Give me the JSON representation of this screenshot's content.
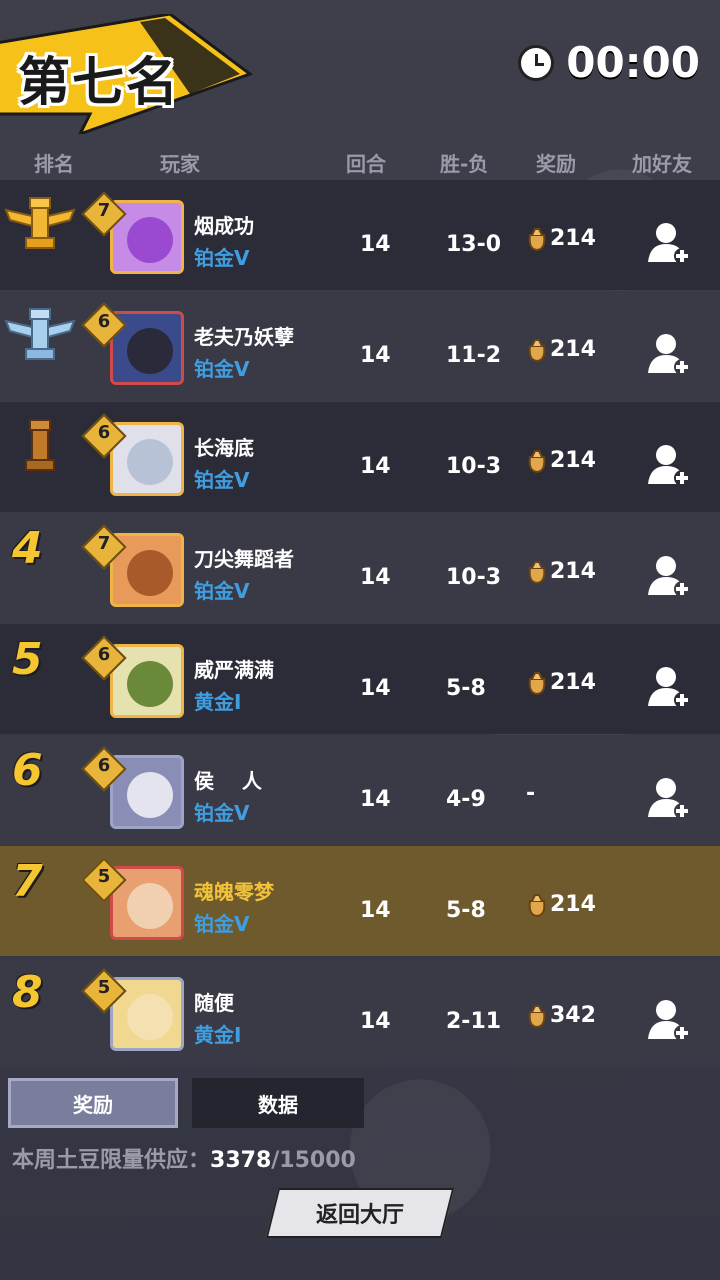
{
  "header": {
    "placement": "第七名",
    "timer": "00:00"
  },
  "columns": {
    "rank": "排名",
    "player": "玩家",
    "rounds": "回合",
    "wl": "胜-负",
    "reward": "奖励",
    "add": "加好友"
  },
  "rows": [
    {
      "rank": "",
      "name": "烟成功",
      "tier": "铂金V",
      "level": "7",
      "rounds": "14",
      "wl": "13-0",
      "reward": "214"
    },
    {
      "rank": "",
      "name": "老夫乃妖孽",
      "tier": "铂金V",
      "level": "6",
      "rounds": "14",
      "wl": "11-2",
      "reward": "214"
    },
    {
      "rank": "",
      "name": "长海底",
      "tier": "铂金V",
      "level": "6",
      "rounds": "14",
      "wl": "10-3",
      "reward": "214"
    },
    {
      "rank": "4",
      "name": "刀尖舞蹈者",
      "tier": "铂金V",
      "level": "7",
      "rounds": "14",
      "wl": "10-3",
      "reward": "214"
    },
    {
      "rank": "5",
      "name": "威严满满",
      "tier": "黄金I",
      "level": "6",
      "rounds": "14",
      "wl": "5-8",
      "reward": "214"
    },
    {
      "rank": "6",
      "name": "侯    人",
      "tier": "铂金V",
      "level": "6",
      "rounds": "14",
      "wl": "4-9",
      "reward": "-"
    },
    {
      "rank": "7",
      "name": "魂魄零梦",
      "tier": "铂金V",
      "level": "5",
      "rounds": "14",
      "wl": "5-8",
      "reward": "214"
    },
    {
      "rank": "8",
      "name": "随便",
      "tier": "黄金I",
      "level": "5",
      "rounds": "14",
      "wl": "2-11",
      "reward": "342"
    }
  ],
  "tabs": {
    "reward": "奖励",
    "data": "数据"
  },
  "supply": {
    "label": "本周土豆限量供应：",
    "current": "3378",
    "total": "/15000"
  },
  "back_button": "返回大厅"
}
